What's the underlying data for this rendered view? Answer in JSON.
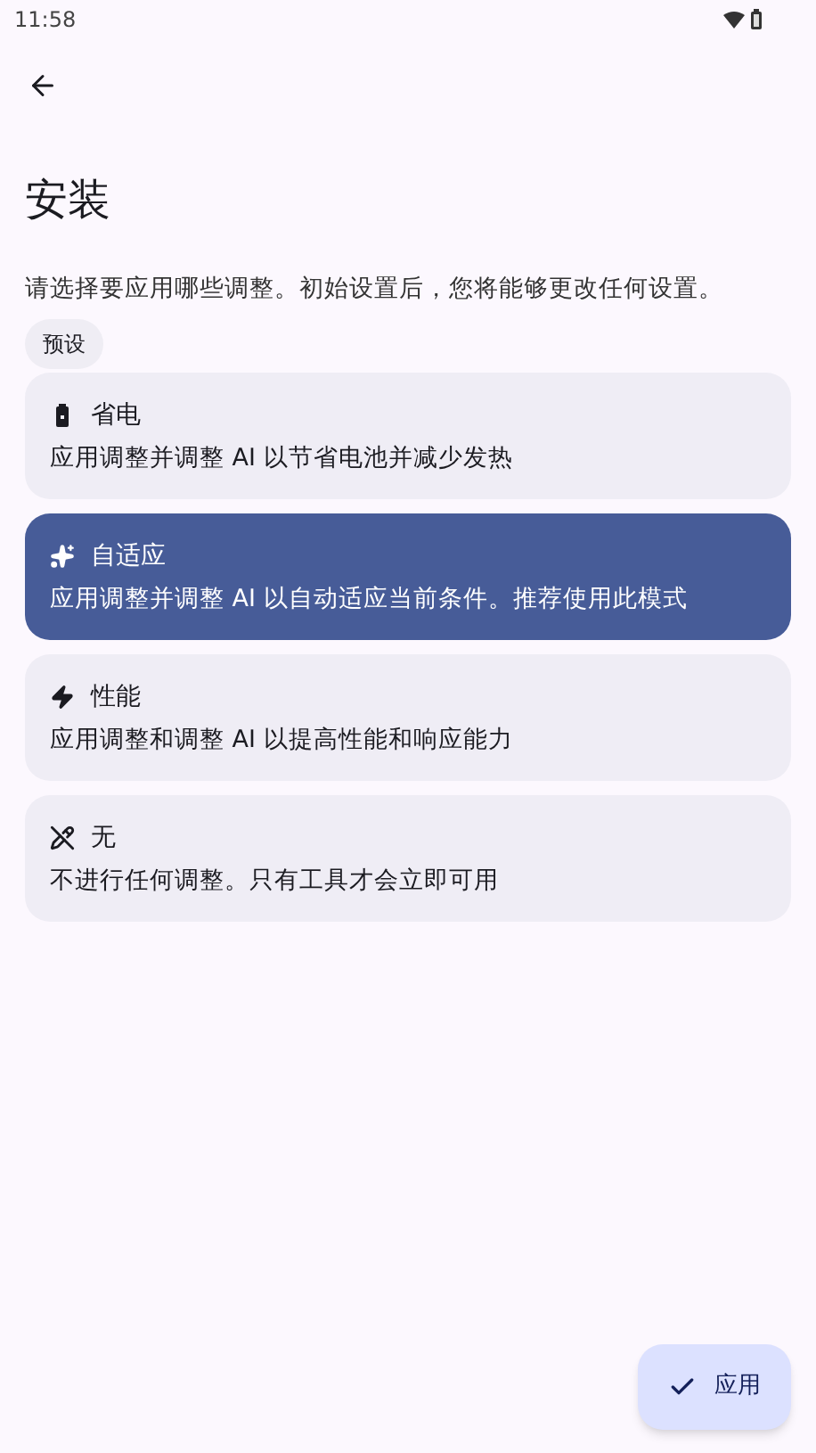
{
  "status_bar": {
    "time": "11:58"
  },
  "title": "安装",
  "description": "请选择要应用哪些调整。初始设置后，您将能够更改任何设置。",
  "chip": "预设",
  "options": [
    {
      "kind": "battery",
      "title": "省电",
      "text": "应用调整并调整 AI 以节省电池并减少发热",
      "selected": false
    },
    {
      "kind": "sparkles",
      "title": "自适应",
      "text": "应用调整并调整 AI 以自动适应当前条件。推荐使用此模式",
      "selected": true
    },
    {
      "kind": "bolt",
      "title": "性能",
      "text": "应用调整和调整 AI 以提高性能和响应能力",
      "selected": false
    },
    {
      "kind": "none",
      "title": "无",
      "text": "不进行任何调整。只有工具才会立即可用",
      "selected": false
    }
  ],
  "fab": {
    "label": "应用"
  }
}
